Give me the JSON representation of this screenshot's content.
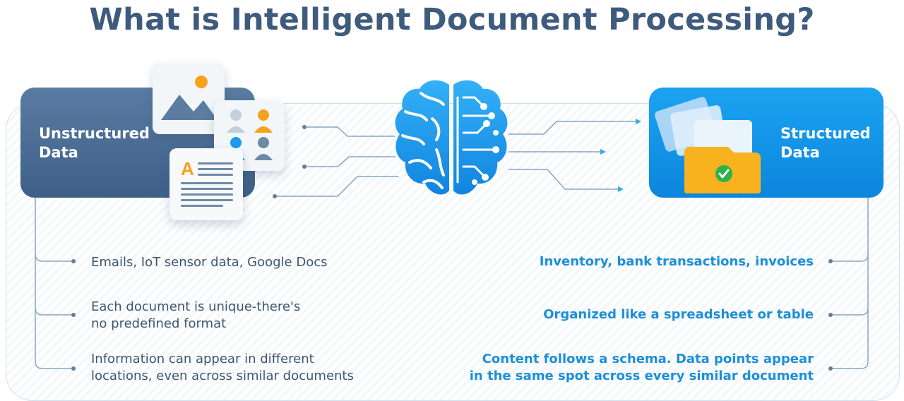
{
  "title": "What is Intelligent Document Processing?",
  "left_panel": {
    "label": "Unstructured\nData"
  },
  "right_panel": {
    "label": "Structured\nData"
  },
  "left_items": [
    "Emails, IoT sensor data, Google Docs",
    "Each document is unique-there's\nno predefined format",
    "Information can appear in different\nlocations, even across similar documents"
  ],
  "right_items": [
    "Inventory, bank transactions, invoices",
    "Organized like a spreadsheet or table",
    "Content follows a schema. Data points appear\nin the same spot across every similar document"
  ],
  "colors": {
    "title": "#3e5b7d",
    "unstructured_panel": "#4a6c93",
    "structured_panel": "#1296e8",
    "brain": "#1d9bf0",
    "left_text": "#3f5670",
    "right_text": "#1c8fd8",
    "accent_orange": "#f6a21d",
    "check_green": "#2bb24c"
  },
  "icons": {
    "image_card": "image-icon",
    "people_card": "users-icon",
    "document_card": "text-document-icon",
    "brain": "brain-icon",
    "folder": "folder-check-icon"
  }
}
